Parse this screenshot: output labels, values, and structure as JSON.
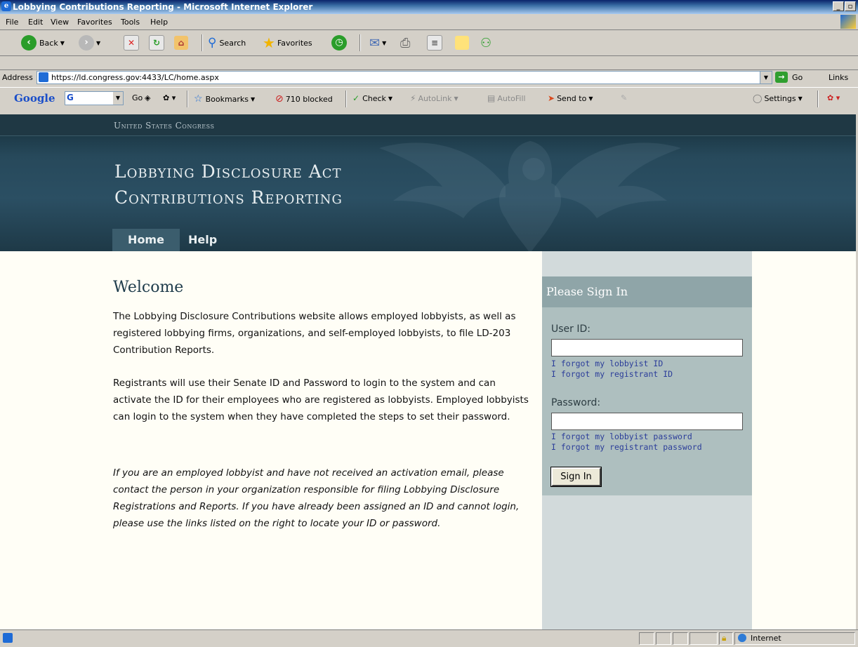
{
  "window": {
    "title": "Lobbying Contributions Reporting - Microsoft Internet Explorer"
  },
  "menu": {
    "file": "File",
    "edit": "Edit",
    "view": "View",
    "favorites": "Favorites",
    "tools": "Tools",
    "help": "Help"
  },
  "toolbar": {
    "back": "Back",
    "search": "Search",
    "favorites": "Favorites"
  },
  "address": {
    "label": "Address",
    "url": "https://ld.congress.gov:4433/LC/home.aspx",
    "go": "Go",
    "links": "Links"
  },
  "google_bar": {
    "logo": "Google",
    "go": "Go",
    "bookmarks": "Bookmarks",
    "blocked": "710 blocked",
    "check": "Check",
    "autolink": "AutoLink",
    "autofill": "AutoFill",
    "send_to": "Send to",
    "settings": "Settings"
  },
  "banner": {
    "top_label": "United States Congress",
    "title_line1": "Lobbying Disclosure Act",
    "title_line2": "Contributions Reporting"
  },
  "nav": {
    "home": "Home",
    "help": "Help"
  },
  "content": {
    "heading": "Welcome",
    "para1": "The Lobbying Disclosure Contributions website allows employed lobbyists, as well as registered lobbying firms, organizations, and self-employed lobbyists, to file LD-203 Contribution Reports.",
    "para2": "Registrants will use their Senate ID and Password to login to the system and can activate the ID for their employees who are registered as lobbyists. Employed lobbyists can login to the system when they have completed the steps to set their password.",
    "para3": "If you are an employed lobbyist and have not received an activation email, please contact the person in your organization responsible for filing Lobbying Disclosure Registrations and Reports. If you have already been assigned an ID and cannot login, please use the links listed on the right to locate your ID or password."
  },
  "signin": {
    "header": "Please Sign In",
    "user_label": "User ID:",
    "user_value": "",
    "forgot_lobbyist_id": "I forgot my lobbyist ID",
    "forgot_registrant_id": "I forgot my registrant ID",
    "password_label": "Password:",
    "password_value": "",
    "forgot_lobbyist_password": "I forgot my lobbyist password",
    "forgot_registrant_password": "I forgot my registrant password",
    "button": "Sign In"
  },
  "status": {
    "zone": "Internet"
  }
}
